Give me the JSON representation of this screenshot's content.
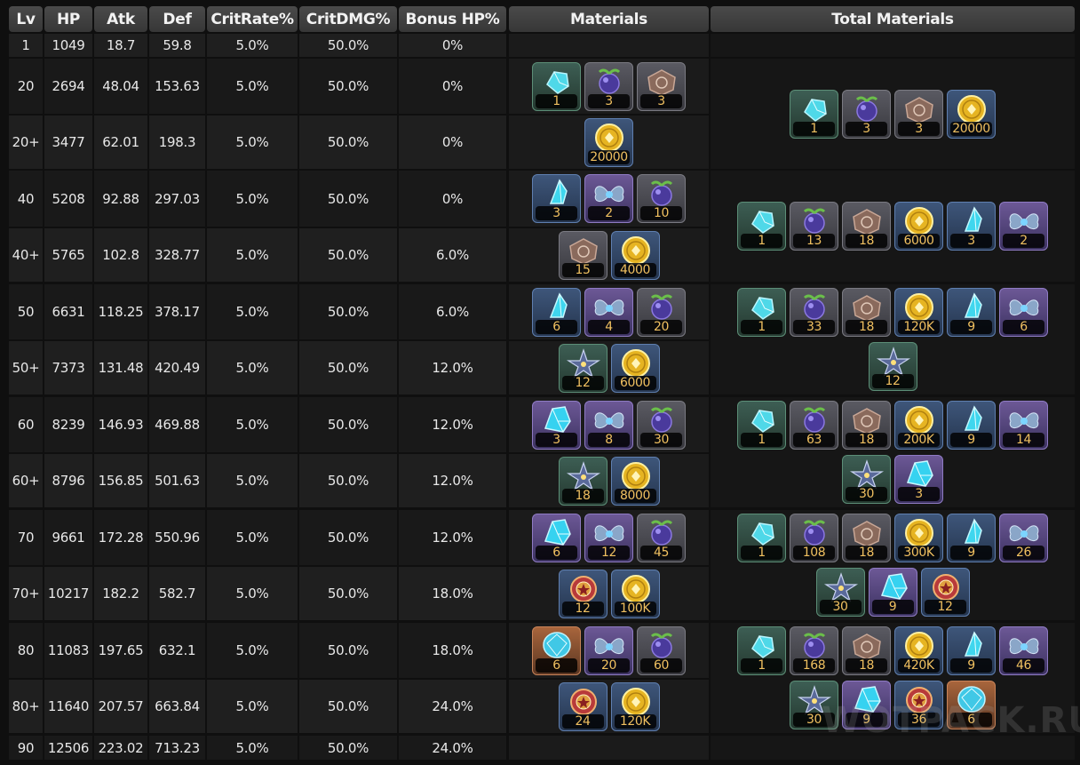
{
  "table": {
    "headers": [
      "Lv",
      "HP",
      "Atk",
      "Def",
      "CritRate%",
      "CritDMG%",
      "Bonus HP%",
      "Materials",
      "Total Materials"
    ],
    "rows": [
      [
        "1",
        "1049",
        "18.7",
        "59.8",
        "5.0%",
        "50.0%",
        "0%"
      ],
      [
        "20",
        "2694",
        "48.04",
        "153.63",
        "5.0%",
        "50.0%",
        "0%"
      ],
      [
        "20+",
        "3477",
        "62.01",
        "198.3",
        "5.0%",
        "50.0%",
        "0%"
      ],
      [
        "40",
        "5208",
        "92.88",
        "297.03",
        "5.0%",
        "50.0%",
        "0%"
      ],
      [
        "40+",
        "5765",
        "102.8",
        "328.77",
        "5.0%",
        "50.0%",
        "6.0%"
      ],
      [
        "50",
        "6631",
        "118.25",
        "378.17",
        "5.0%",
        "50.0%",
        "6.0%"
      ],
      [
        "50+",
        "7373",
        "131.48",
        "420.49",
        "5.0%",
        "50.0%",
        "12.0%"
      ],
      [
        "60",
        "8239",
        "146.93",
        "469.88",
        "5.0%",
        "50.0%",
        "12.0%"
      ],
      [
        "60+",
        "8796",
        "156.85",
        "501.63",
        "5.0%",
        "50.0%",
        "12.0%"
      ],
      [
        "70",
        "9661",
        "172.28",
        "550.96",
        "5.0%",
        "50.0%",
        "12.0%"
      ],
      [
        "70+",
        "10217",
        "182.2",
        "582.7",
        "5.0%",
        "50.0%",
        "18.0%"
      ],
      [
        "80",
        "11083",
        "197.65",
        "632.1",
        "5.0%",
        "50.0%",
        "18.0%"
      ],
      [
        "80+",
        "11640",
        "207.57",
        "663.84",
        "5.0%",
        "50.0%",
        "24.0%"
      ],
      [
        "90",
        "12506",
        "223.02",
        "713.23",
        "5.0%",
        "50.0%",
        "24.0%"
      ]
    ]
  },
  "materials": [
    [],
    [
      {
        "icon": "crystal-sliver-icon",
        "rarity": "green",
        "count": "1"
      },
      {
        "icon": "berry-icon",
        "rarity": "gray",
        "count": "3"
      },
      {
        "icon": "emblem-icon",
        "rarity": "gray",
        "count": "3"
      }
    ],
    [
      {
        "icon": "coin-icon",
        "rarity": "blue",
        "count": "20000"
      }
    ],
    [
      {
        "icon": "crystal-shard-icon",
        "rarity": "blue",
        "count": "3"
      },
      {
        "icon": "flower-icon",
        "rarity": "purple",
        "count": "2"
      },
      {
        "icon": "berry-icon",
        "rarity": "gray",
        "count": "10"
      }
    ],
    [
      {
        "icon": "emblem-icon",
        "rarity": "gray",
        "count": "15"
      },
      {
        "icon": "coin-icon",
        "rarity": "blue",
        "count": "4000"
      }
    ],
    [
      {
        "icon": "crystal-shard-icon",
        "rarity": "blue",
        "count": "6"
      },
      {
        "icon": "flower-icon",
        "rarity": "purple",
        "count": "4"
      },
      {
        "icon": "berry-icon",
        "rarity": "gray",
        "count": "20"
      }
    ],
    [
      {
        "icon": "star-core-icon",
        "rarity": "green",
        "count": "12"
      },
      {
        "icon": "coin-icon",
        "rarity": "blue",
        "count": "6000"
      }
    ],
    [
      {
        "icon": "crystal-chunk-icon",
        "rarity": "purple",
        "count": "3"
      },
      {
        "icon": "flower-icon",
        "rarity": "purple",
        "count": "8"
      },
      {
        "icon": "berry-icon",
        "rarity": "gray",
        "count": "30"
      }
    ],
    [
      {
        "icon": "star-core-icon",
        "rarity": "green",
        "count": "18"
      },
      {
        "icon": "coin-icon",
        "rarity": "blue",
        "count": "8000"
      }
    ],
    [
      {
        "icon": "crystal-chunk-icon",
        "rarity": "purple",
        "count": "6"
      },
      {
        "icon": "flower-icon",
        "rarity": "purple",
        "count": "12"
      },
      {
        "icon": "berry-icon",
        "rarity": "gray",
        "count": "45"
      }
    ],
    [
      {
        "icon": "medal-icon",
        "rarity": "blue",
        "count": "12"
      },
      {
        "icon": "coin-icon",
        "rarity": "blue",
        "count": "100K"
      }
    ],
    [
      {
        "icon": "crystal-gem-icon",
        "rarity": "orange",
        "count": "6"
      },
      {
        "icon": "flower-icon",
        "rarity": "purple",
        "count": "20"
      },
      {
        "icon": "berry-icon",
        "rarity": "gray",
        "count": "60"
      }
    ],
    [
      {
        "icon": "medal-icon",
        "rarity": "blue",
        "count": "24"
      },
      {
        "icon": "coin-icon",
        "rarity": "blue",
        "count": "120K"
      }
    ],
    []
  ],
  "totals": [
    {
      "start": 0,
      "span": 1,
      "items": []
    },
    {
      "start": 1,
      "span": 2,
      "items": [
        {
          "icon": "crystal-sliver-icon",
          "rarity": "green",
          "count": "1"
        },
        {
          "icon": "berry-icon",
          "rarity": "gray",
          "count": "3"
        },
        {
          "icon": "emblem-icon",
          "rarity": "gray",
          "count": "3"
        },
        {
          "icon": "coin-icon",
          "rarity": "blue",
          "count": "20000"
        }
      ]
    },
    {
      "start": 3,
      "span": 2,
      "items": [
        {
          "icon": "crystal-sliver-icon",
          "rarity": "green",
          "count": "1"
        },
        {
          "icon": "berry-icon",
          "rarity": "gray",
          "count": "13"
        },
        {
          "icon": "emblem-icon",
          "rarity": "gray",
          "count": "18"
        },
        {
          "icon": "coin-icon",
          "rarity": "blue",
          "count": "6000"
        },
        {
          "icon": "crystal-shard-icon",
          "rarity": "blue",
          "count": "3"
        },
        {
          "icon": "flower-icon",
          "rarity": "purple",
          "count": "2"
        }
      ]
    },
    {
      "start": 5,
      "span": 2,
      "items": [
        {
          "icon": "crystal-sliver-icon",
          "rarity": "green",
          "count": "1"
        },
        {
          "icon": "berry-icon",
          "rarity": "gray",
          "count": "33"
        },
        {
          "icon": "emblem-icon",
          "rarity": "gray",
          "count": "18"
        },
        {
          "icon": "coin-icon",
          "rarity": "blue",
          "count": "120K"
        },
        {
          "icon": "crystal-shard-icon",
          "rarity": "blue",
          "count": "9"
        },
        {
          "icon": "flower-icon",
          "rarity": "purple",
          "count": "6"
        },
        {
          "icon": "star-core-icon",
          "rarity": "green",
          "count": "12"
        }
      ]
    },
    {
      "start": 7,
      "span": 2,
      "items": [
        {
          "icon": "crystal-sliver-icon",
          "rarity": "green",
          "count": "1"
        },
        {
          "icon": "berry-icon",
          "rarity": "gray",
          "count": "63"
        },
        {
          "icon": "emblem-icon",
          "rarity": "gray",
          "count": "18"
        },
        {
          "icon": "coin-icon",
          "rarity": "blue",
          "count": "200K"
        },
        {
          "icon": "crystal-shard-icon",
          "rarity": "blue",
          "count": "9"
        },
        {
          "icon": "flower-icon",
          "rarity": "purple",
          "count": "14"
        },
        {
          "icon": "star-core-icon",
          "rarity": "green",
          "count": "30"
        },
        {
          "icon": "crystal-chunk-icon",
          "rarity": "purple",
          "count": "3"
        }
      ]
    },
    {
      "start": 9,
      "span": 2,
      "items": [
        {
          "icon": "crystal-sliver-icon",
          "rarity": "green",
          "count": "1"
        },
        {
          "icon": "berry-icon",
          "rarity": "gray",
          "count": "108"
        },
        {
          "icon": "emblem-icon",
          "rarity": "gray",
          "count": "18"
        },
        {
          "icon": "coin-icon",
          "rarity": "blue",
          "count": "300K"
        },
        {
          "icon": "crystal-shard-icon",
          "rarity": "blue",
          "count": "9"
        },
        {
          "icon": "flower-icon",
          "rarity": "purple",
          "count": "26"
        },
        {
          "icon": "star-core-icon",
          "rarity": "green",
          "count": "30"
        },
        {
          "icon": "crystal-chunk-icon",
          "rarity": "purple",
          "count": "9"
        },
        {
          "icon": "medal-icon",
          "rarity": "blue",
          "count": "12"
        }
      ]
    },
    {
      "start": 11,
      "span": 2,
      "items": [
        {
          "icon": "crystal-sliver-icon",
          "rarity": "green",
          "count": "1"
        },
        {
          "icon": "berry-icon",
          "rarity": "gray",
          "count": "168"
        },
        {
          "icon": "emblem-icon",
          "rarity": "gray",
          "count": "18"
        },
        {
          "icon": "coin-icon",
          "rarity": "blue",
          "count": "420K"
        },
        {
          "icon": "crystal-shard-icon",
          "rarity": "blue",
          "count": "9"
        },
        {
          "icon": "flower-icon",
          "rarity": "purple",
          "count": "46"
        },
        {
          "icon": "star-core-icon",
          "rarity": "green",
          "count": "30"
        },
        {
          "icon": "crystal-chunk-icon",
          "rarity": "purple",
          "count": "9"
        },
        {
          "icon": "medal-icon",
          "rarity": "blue",
          "count": "36"
        },
        {
          "icon": "crystal-gem-icon",
          "rarity": "orange",
          "count": "6"
        }
      ]
    },
    {
      "start": 13,
      "span": 1,
      "items": []
    }
  ],
  "watermark": "WOTPACK.RU"
}
